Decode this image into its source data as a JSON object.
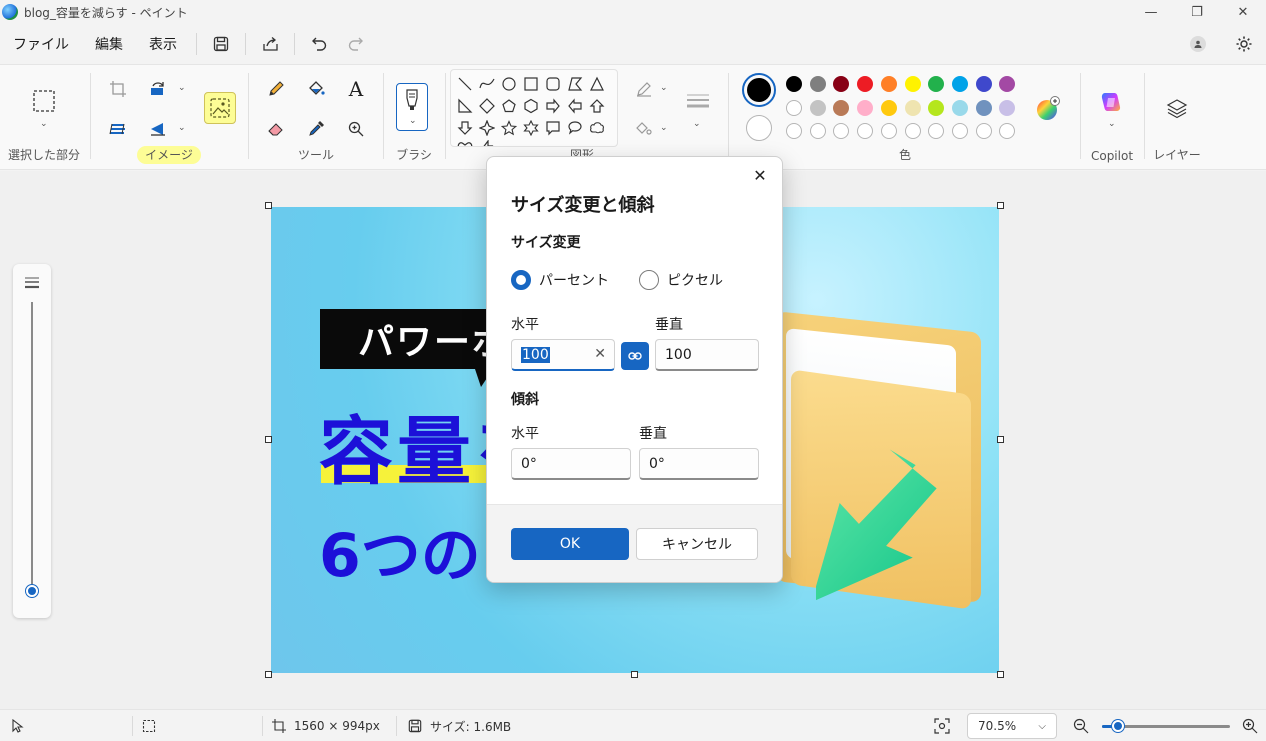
{
  "window": {
    "title": "blog_容量を減らす - ペイント",
    "minimize_glyph": "—",
    "restore_glyph": "❐",
    "close_glyph": "✕"
  },
  "menu": {
    "file": "ファイル",
    "edit": "編集",
    "view": "表示"
  },
  "ribbon": {
    "selection_label": "選択した部分",
    "image_label": "イメージ",
    "tools_label": "ツール",
    "brushes_label": "ブラシ",
    "shapes_label": "図形",
    "colors_label": "色",
    "copilot_label": "Copilot",
    "layers_label": "レイヤー",
    "text_tool_glyph": "A"
  },
  "colors": {
    "primary": "#000000",
    "secondary": "#ffffff",
    "palette_row1": [
      "#000000",
      "#7f7f7f",
      "#880015",
      "#ed1c24",
      "#ff7f27",
      "#fff200",
      "#22b14c",
      "#00a2e8",
      "#3f48cc",
      "#a349a4"
    ],
    "palette_row2": [
      "#ffffff",
      "#c3c3c3",
      "#b97a57",
      "#ffaec9",
      "#ffc90e",
      "#efe4b0",
      "#b5e61d",
      "#99d9ea",
      "#7092be",
      "#c8bfe7"
    ],
    "accent": "#1766c2"
  },
  "canvas_image": {
    "banner_text": "パワーポ",
    "headline_text": "容量を",
    "sub_text": "6つの"
  },
  "dialog": {
    "title": "サイズ変更と傾斜",
    "close_glyph": "✕",
    "resize_section": "サイズ変更",
    "radio_percent": "パーセント",
    "radio_pixel": "ピクセル",
    "resize_horizontal_label": "水平",
    "resize_vertical_label": "垂直",
    "resize_horizontal_value": "100",
    "resize_vertical_value": "100",
    "skew_section": "傾斜",
    "skew_horizontal_label": "水平",
    "skew_vertical_label": "垂直",
    "skew_horizontal_value": "0°",
    "skew_vertical_value": "0°",
    "ok_label": "OK",
    "cancel_label": "キャンセル"
  },
  "statusbar": {
    "dimensions": "1560 × 994px",
    "size": "サイズ: 1.6MB",
    "zoom": "70.5%"
  },
  "icons": [
    "app-icon",
    "save-icon",
    "share-icon",
    "undo-icon",
    "redo-icon",
    "settings-icon",
    "select-icon",
    "crop-icon",
    "rotate-icon",
    "flip-icon",
    "pencil-icon",
    "fill-icon",
    "text-icon",
    "eraser-icon",
    "picker-icon",
    "magnifier-icon",
    "brush-icon",
    "copilot-icon",
    "layers-icon",
    "color-wheel-icon",
    "pointer-icon",
    "zoom-out-icon",
    "zoom-in-icon"
  ]
}
